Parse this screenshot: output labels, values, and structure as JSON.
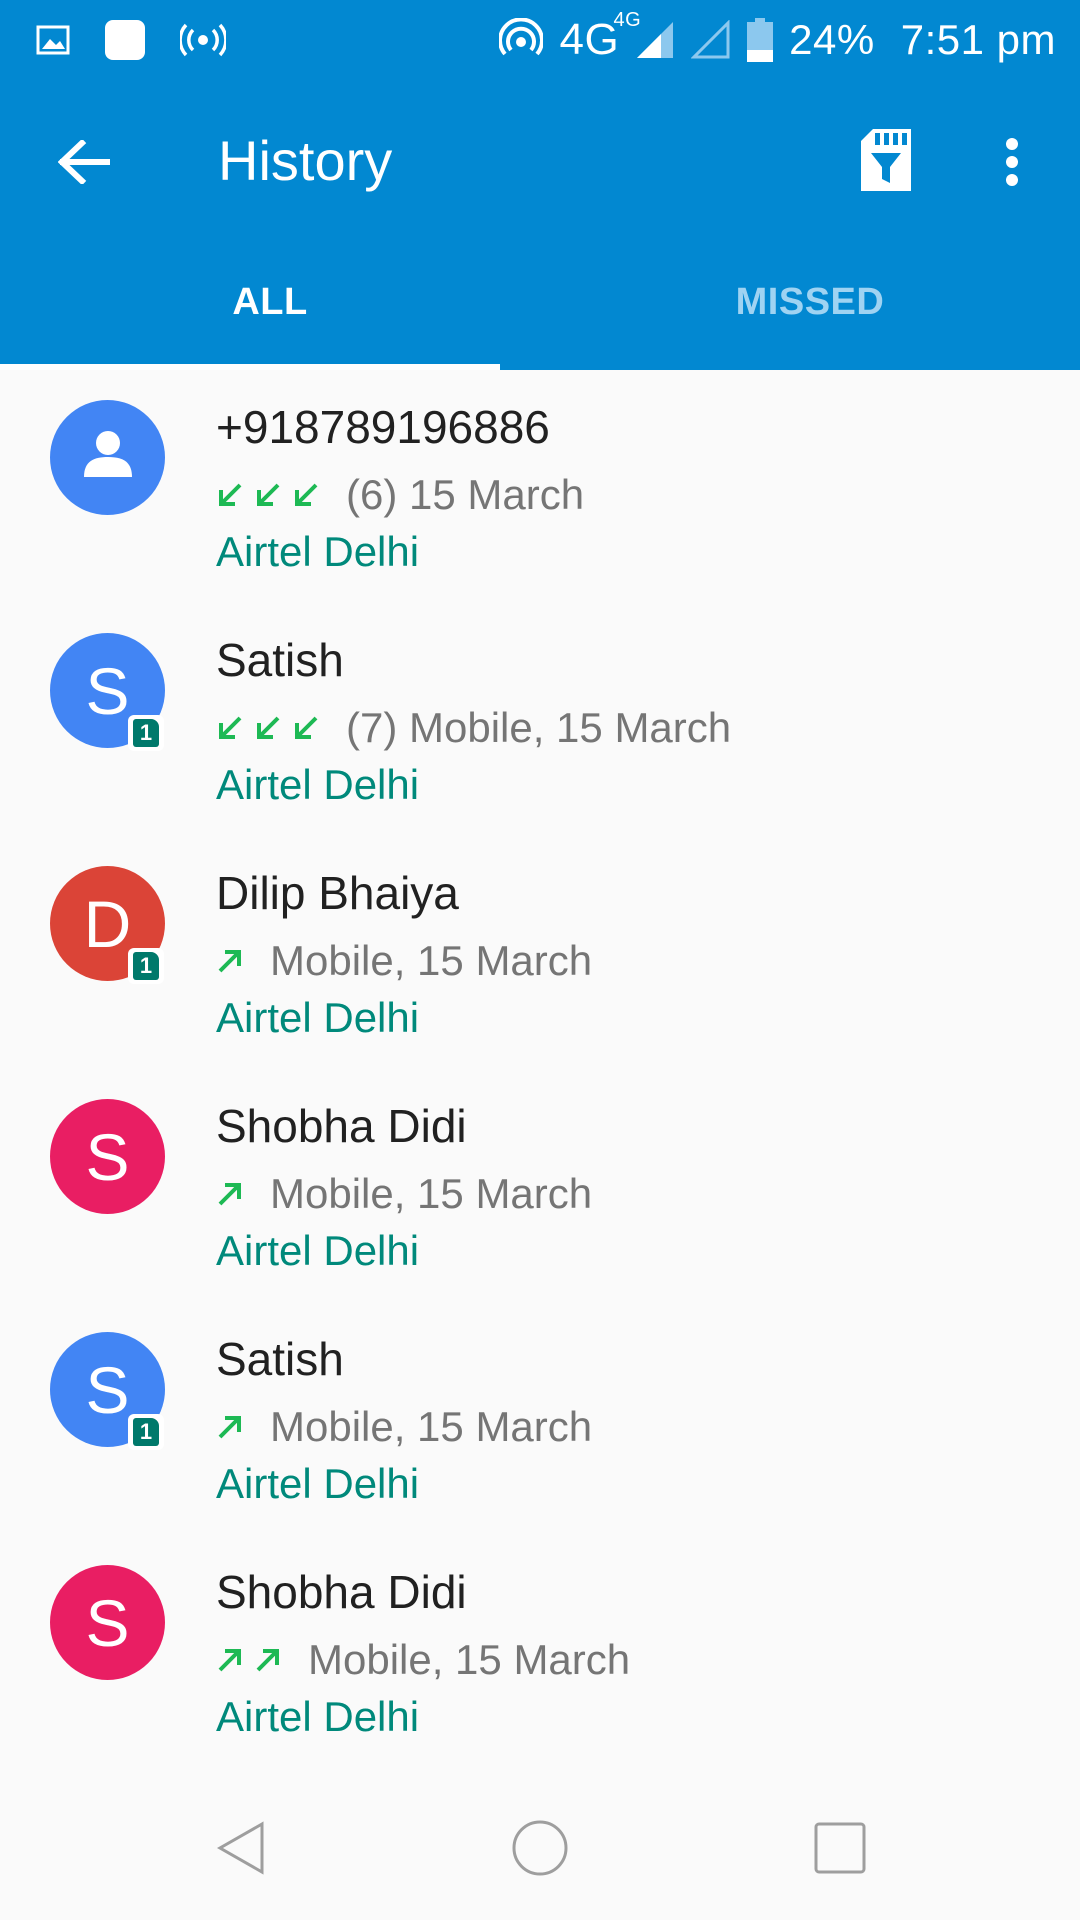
{
  "status_bar": {
    "network": "4G",
    "network_sup": "4G",
    "battery": "24%",
    "time": "7:51 pm"
  },
  "app_bar": {
    "title": "History"
  },
  "tabs": [
    {
      "label": "ALL",
      "active": true
    },
    {
      "label": "MISSED",
      "active": false
    }
  ],
  "calls": [
    {
      "name": "+918789196886",
      "avatar_type": "person-icon",
      "avatar_color": "#4285f4",
      "sim": "",
      "arrow_type": "incoming",
      "arrow_count": 3,
      "detail": "(6) 15 March",
      "carrier": "Airtel Delhi"
    },
    {
      "name": "Satish",
      "avatar_letter": "S",
      "avatar_color": "#4285f4",
      "sim": "1",
      "arrow_type": "incoming",
      "arrow_count": 3,
      "detail": "(7) Mobile, 15 March",
      "carrier": "Airtel Delhi"
    },
    {
      "name": "Dilip Bhaiya",
      "avatar_letter": "D",
      "avatar_color": "#db4437",
      "sim": "1",
      "arrow_type": "outgoing",
      "arrow_count": 1,
      "detail": "Mobile, 15 March",
      "carrier": "Airtel Delhi"
    },
    {
      "name": "Shobha Didi",
      "avatar_letter": "S",
      "avatar_color": "#e91e63",
      "sim": "",
      "arrow_type": "outgoing",
      "arrow_count": 1,
      "detail": "Mobile, 15 March",
      "carrier": "Airtel Delhi"
    },
    {
      "name": "Satish",
      "avatar_letter": "S",
      "avatar_color": "#4285f4",
      "sim": "1",
      "arrow_type": "outgoing",
      "arrow_count": 1,
      "detail": "Mobile, 15 March",
      "carrier": "Airtel Delhi"
    },
    {
      "name": "Shobha Didi",
      "avatar_letter": "S",
      "avatar_color": "#e91e63",
      "sim": "",
      "arrow_type": "outgoing",
      "arrow_count": 2,
      "detail": "Mobile, 15 March",
      "carrier": "Airtel Delhi"
    }
  ],
  "colors": {
    "primary": "#0288d1",
    "call_arrow": "#1db954",
    "carrier_text": "#00897b",
    "sim_badge": "#00796b"
  }
}
